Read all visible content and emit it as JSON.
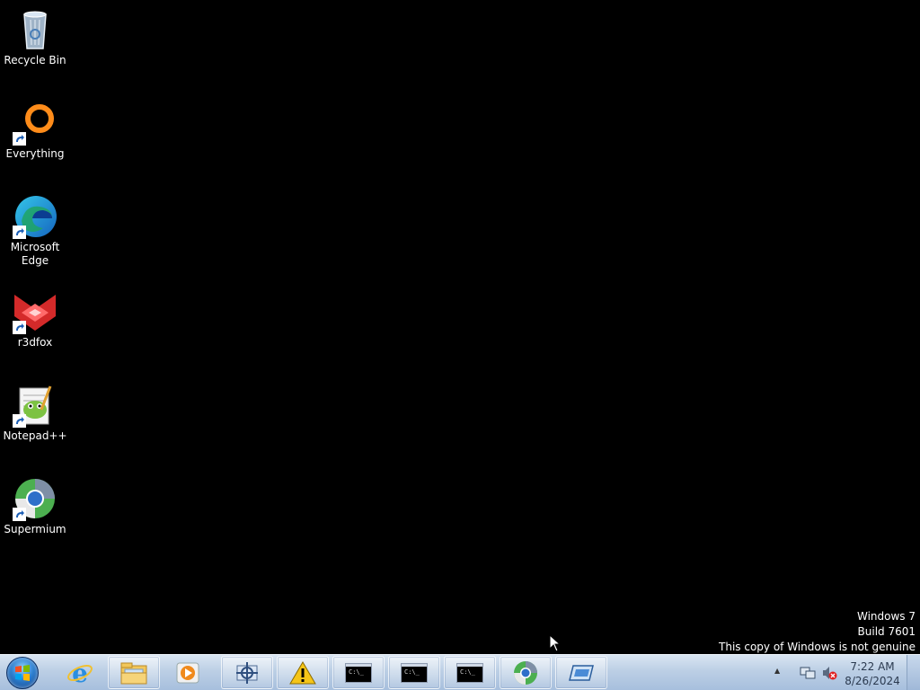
{
  "desktop": {
    "icons": [
      {
        "label": "Recycle Bin"
      },
      {
        "label": "Everything"
      },
      {
        "label": "Microsoft Edge"
      },
      {
        "label": "r3dfox"
      },
      {
        "label": "Notepad++"
      },
      {
        "label": "Supermium"
      }
    ],
    "watermark": {
      "line1": "Windows 7",
      "line2": "Build 7601",
      "line3": "This copy of Windows is not genuine"
    }
  },
  "taskbar": {
    "pinned": [
      "start-orb",
      "internet-explorer-icon",
      "windows-explorer-icon",
      "media-player-icon",
      "control-panel-icon",
      "warning-icon",
      "command-prompt-icon",
      "command-prompt-icon",
      "command-prompt-icon",
      "supermium-icon",
      "window-icon"
    ],
    "cmd_text": "C:\\_",
    "clock": {
      "time": "7:22 AM",
      "date": "8/26/2024"
    }
  },
  "colors": {
    "desktop_background": "#000000",
    "taskbar_top": "#d9e5f2",
    "taskbar_bottom": "#a7bfdd",
    "label_text": "#ffffff"
  }
}
